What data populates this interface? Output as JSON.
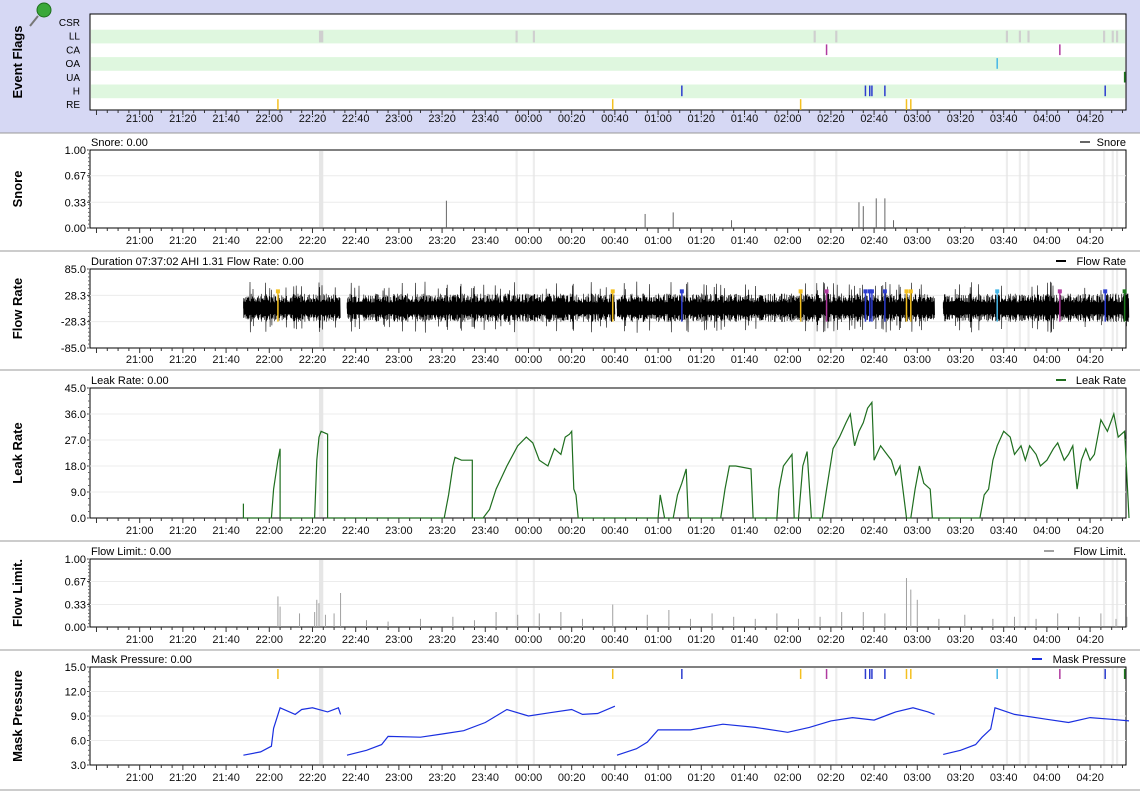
{
  "time_ticks": [
    "21:00",
    "21:20",
    "21:40",
    "22:00",
    "22:20",
    "22:40",
    "23:00",
    "23:20",
    "23:40",
    "00:00",
    "00:20",
    "00:40",
    "01:00",
    "01:20",
    "01:40",
    "02:00",
    "02:20",
    "02:40",
    "03:00",
    "03:20",
    "03:40",
    "04:00",
    "04:20"
  ],
  "colors": {
    "flag_band": "#dff7df",
    "flags_panel_bg": "#d6d8f4",
    "RE": "#f4c020",
    "H": "#2c3ccf",
    "CA": "#b03a9f",
    "OA": "#46b6e6",
    "UA": "#1b7a1b",
    "LL": "#cfcfcf",
    "snore": "#666666",
    "flow": "#000000",
    "leak": "#1f6e1f",
    "flowlim": "#a0a0a0",
    "pressure": "#1a2fe0"
  },
  "icons": {
    "flags_icon": "pushpin-icon"
  },
  "chart_data": [
    {
      "type": "event-flags",
      "ylabel": "Event Flags",
      "rows": [
        "CSR",
        "LL",
        "CA",
        "OA",
        "UA",
        "H",
        "RE"
      ],
      "events": {
        "LL": [
          [
            "22:23",
            "22:25"
          ],
          [
            "23:54",
            "23:55"
          ],
          [
            "00:02",
            "00:03"
          ],
          [
            "02:12",
            "02:13"
          ],
          [
            "02:22",
            "02:23"
          ],
          [
            "03:41",
            "03:42"
          ],
          [
            "03:47",
            "03:48"
          ],
          [
            "03:51",
            "03:52"
          ],
          [
            "04:26",
            "04:27"
          ],
          [
            "04:30",
            "04:31"
          ],
          [
            "04:32",
            "04:33"
          ]
        ],
        "CA": [
          "02:18",
          "04:06"
        ],
        "OA": [
          "03:37"
        ],
        "UA": [
          "04:36"
        ],
        "H": [
          "01:11",
          "02:36",
          "02:38",
          "02:39",
          "02:45",
          "04:27"
        ],
        "RE": [
          "22:04",
          "00:39",
          "02:06",
          "02:55",
          "02:57"
        ]
      }
    },
    {
      "type": "line",
      "ylabel": "Snore",
      "title": "Snore: 0.00",
      "legend": "Snore",
      "yticks": [
        "1.00",
        "0.67",
        "0.33",
        "0.00"
      ],
      "ylim": [
        0,
        1
      ],
      "spikes": [
        [
          "23:22",
          0.35
        ],
        [
          "00:54",
          0.18
        ],
        [
          "01:07",
          0.2
        ],
        [
          "01:34",
          0.1
        ],
        [
          "02:33",
          0.33
        ],
        [
          "02:35",
          0.28
        ],
        [
          "02:41",
          0.38
        ],
        [
          "02:45",
          0.38
        ],
        [
          "02:49",
          0.1
        ],
        [
          "03:22",
          0.02
        ]
      ]
    },
    {
      "type": "line",
      "ylabel": "Flow Rate",
      "title": "Duration 07:37:02 AHI 1.31 Flow Rate: 0.00",
      "legend": "Flow Rate",
      "yticks": [
        "85.0",
        "28.3",
        "-28.3",
        "-85.0"
      ],
      "ylim": [
        -85,
        85
      ],
      "segments": [
        [
          "21:48",
          "22:33"
        ],
        [
          "22:36",
          "00:40"
        ],
        [
          "00:41",
          "03:08"
        ],
        [
          "03:12",
          "04:38"
        ]
      ]
    },
    {
      "type": "line",
      "ylabel": "Leak Rate",
      "title": "Leak Rate: 0.00",
      "legend": "Leak Rate",
      "yticks": [
        "45.0",
        "36.0",
        "27.0",
        "18.0",
        "9.0",
        "0.0"
      ],
      "ylim": [
        0,
        45
      ],
      "points": [
        [
          "21:48",
          0
        ],
        [
          "21:48",
          5
        ],
        [
          "21:48",
          0
        ],
        [
          "22:01",
          0
        ],
        [
          "22:02",
          10
        ],
        [
          "22:04",
          20
        ],
        [
          "22:05",
          24
        ],
        [
          "22:05",
          0
        ],
        [
          "22:21",
          0
        ],
        [
          "22:22",
          20
        ],
        [
          "22:23",
          28
        ],
        [
          "22:24",
          30
        ],
        [
          "22:27",
          29
        ],
        [
          "22:27",
          0
        ],
        [
          "23:21",
          0
        ],
        [
          "23:23",
          8
        ],
        [
          "23:25",
          18
        ],
        [
          "23:26",
          21
        ],
        [
          "23:29",
          20
        ],
        [
          "23:34",
          20
        ],
        [
          "23:34",
          0
        ],
        [
          "23:39",
          0
        ],
        [
          "23:42",
          3
        ],
        [
          "23:45",
          10
        ],
        [
          "23:50",
          18
        ],
        [
          "23:55",
          25
        ],
        [
          "23:59",
          28
        ],
        [
          "00:02",
          26
        ],
        [
          "00:05",
          20
        ],
        [
          "00:09",
          18
        ],
        [
          "00:12",
          24
        ],
        [
          "00:15",
          22
        ],
        [
          "00:17",
          28
        ],
        [
          "00:19",
          29
        ],
        [
          "00:20",
          30
        ],
        [
          "00:21",
          10
        ],
        [
          "00:22",
          8
        ],
        [
          "00:23",
          0
        ],
        [
          "01:00",
          0
        ],
        [
          "01:01",
          8
        ],
        [
          "01:03",
          0
        ],
        [
          "01:07",
          0
        ],
        [
          "01:09",
          8
        ],
        [
          "01:11",
          12
        ],
        [
          "01:13",
          17
        ],
        [
          "01:14",
          0
        ],
        [
          "01:29",
          0
        ],
        [
          "01:31",
          10
        ],
        [
          "01:33",
          18
        ],
        [
          "01:36",
          18
        ],
        [
          "01:43",
          17
        ],
        [
          "01:44",
          0
        ],
        [
          "01:55",
          0
        ],
        [
          "01:56",
          10
        ],
        [
          "01:58",
          18
        ],
        [
          "02:02",
          22
        ],
        [
          "02:03",
          0
        ],
        [
          "02:05",
          0
        ],
        [
          "02:07",
          18
        ],
        [
          "02:09",
          23
        ],
        [
          "02:11",
          0
        ],
        [
          "02:16",
          0
        ],
        [
          "02:18",
          10
        ],
        [
          "02:21",
          24
        ],
        [
          "02:24",
          28
        ],
        [
          "02:27",
          33
        ],
        [
          "02:29",
          36
        ],
        [
          "02:31",
          25
        ],
        [
          "02:33",
          30
        ],
        [
          "02:35",
          33
        ],
        [
          "02:37",
          38
        ],
        [
          "02:39",
          40
        ],
        [
          "02:40",
          20
        ],
        [
          "02:43",
          25
        ],
        [
          "02:45",
          23
        ],
        [
          "02:48",
          20
        ],
        [
          "02:50",
          15
        ],
        [
          "02:52",
          18
        ],
        [
          "02:55",
          0
        ],
        [
          "02:57",
          0
        ],
        [
          "02:59",
          10
        ],
        [
          "03:01",
          18
        ],
        [
          "03:03",
          12
        ],
        [
          "03:06",
          10
        ],
        [
          "03:07",
          0
        ],
        [
          "03:29",
          0
        ],
        [
          "03:31",
          8
        ],
        [
          "03:33",
          10
        ],
        [
          "03:35",
          20
        ],
        [
          "03:37",
          25
        ],
        [
          "03:40",
          30
        ],
        [
          "03:43",
          28
        ],
        [
          "03:45",
          22
        ],
        [
          "03:48",
          25
        ],
        [
          "03:50",
          20
        ],
        [
          "03:52",
          25
        ],
        [
          "03:55",
          22
        ],
        [
          "03:57",
          18
        ],
        [
          "04:00",
          20
        ],
        [
          "04:03",
          24
        ],
        [
          "04:05",
          26
        ],
        [
          "04:08",
          20
        ],
        [
          "04:10",
          22
        ],
        [
          "04:12",
          25
        ],
        [
          "04:14",
          10
        ],
        [
          "04:16",
          20
        ],
        [
          "04:18",
          24
        ],
        [
          "04:20",
          20
        ],
        [
          "04:22",
          22
        ],
        [
          "04:25",
          34
        ],
        [
          "04:28",
          30
        ],
        [
          "04:31",
          36
        ],
        [
          "04:33",
          28
        ],
        [
          "04:36",
          30
        ],
        [
          "04:38",
          0
        ]
      ]
    },
    {
      "type": "line",
      "ylabel": "Flow Limit.",
      "title": "Flow Limit.: 0.00",
      "legend": "Flow Limit.",
      "yticks": [
        "1.00",
        "0.67",
        "0.33",
        "0.00"
      ],
      "ylim": [
        0,
        1
      ],
      "spikes": [
        [
          "22:04",
          0.45
        ],
        [
          "22:05",
          0.3
        ],
        [
          "22:14",
          0.2
        ],
        [
          "22:21",
          0.22
        ],
        [
          "22:22",
          0.4
        ],
        [
          "22:23",
          0.35
        ],
        [
          "22:26",
          0.18
        ],
        [
          "22:30",
          0.2
        ],
        [
          "22:33",
          0.5
        ],
        [
          "22:45",
          0.1
        ],
        [
          "22:55",
          0.08
        ],
        [
          "23:10",
          0.12
        ],
        [
          "23:25",
          0.15
        ],
        [
          "23:35",
          0.1
        ],
        [
          "23:45",
          0.22
        ],
        [
          "23:55",
          0.18
        ],
        [
          "00:05",
          0.2
        ],
        [
          "00:15",
          0.22
        ],
        [
          "00:25",
          0.12
        ],
        [
          "00:39",
          0.33
        ],
        [
          "00:55",
          0.18
        ],
        [
          "01:05",
          0.25
        ],
        [
          "01:15",
          0.12
        ],
        [
          "01:25",
          0.2
        ],
        [
          "01:35",
          0.15
        ],
        [
          "01:45",
          0.12
        ],
        [
          "01:55",
          0.2
        ],
        [
          "02:05",
          0.12
        ],
        [
          "02:15",
          0.15
        ],
        [
          "02:25",
          0.22
        ],
        [
          "02:35",
          0.22
        ],
        [
          "02:45",
          0.2
        ],
        [
          "02:55",
          0.72
        ],
        [
          "02:57",
          0.55
        ],
        [
          "03:00",
          0.4
        ],
        [
          "03:10",
          0.12
        ],
        [
          "03:22",
          0.18
        ],
        [
          "03:35",
          0.12
        ],
        [
          "03:45",
          0.15
        ],
        [
          "03:55",
          0.12
        ],
        [
          "04:05",
          0.2
        ],
        [
          "04:15",
          0.15
        ],
        [
          "04:25",
          0.2
        ],
        [
          "04:32",
          0.12
        ],
        [
          "04:37",
          0.15
        ]
      ]
    },
    {
      "type": "line",
      "ylabel": "Mask Pressure",
      "title": "Mask Pressure: 0.00",
      "legend": "Mask Pressure",
      "yticks": [
        "15.0",
        "12.0",
        "9.0",
        "6.0",
        "3.0"
      ],
      "ylim": [
        3,
        15
      ],
      "points": [
        [
          "21:48",
          4.2
        ],
        [
          "21:56",
          4.6
        ],
        [
          "22:01",
          5.3
        ],
        [
          "22:02",
          7.5
        ],
        [
          "22:05",
          10
        ],
        [
          "22:12",
          9.2
        ],
        [
          "22:15",
          9.8
        ],
        [
          "22:20",
          10
        ],
        [
          "22:27",
          9.5
        ],
        [
          "22:32",
          10
        ],
        [
          "22:33",
          9.2
        ],
        null,
        [
          "22:36",
          4.2
        ],
        [
          "22:45",
          4.8
        ],
        [
          "22:52",
          5.5
        ],
        [
          "22:55",
          6.5
        ],
        [
          "23:10",
          6.4
        ],
        [
          "23:20",
          6.8
        ],
        [
          "23:30",
          7.2
        ],
        [
          "23:40",
          8.2
        ],
        [
          "23:50",
          9.8
        ],
        [
          "00:00",
          9.0
        ],
        [
          "00:10",
          9.4
        ],
        [
          "00:20",
          9.8
        ],
        [
          "00:25",
          9.2
        ],
        [
          "00:32",
          9.3
        ],
        [
          "00:40",
          10.2
        ],
        null,
        [
          "00:41",
          4.2
        ],
        [
          "00:50",
          5
        ],
        [
          "00:55",
          5.8
        ],
        [
          "01:00",
          7.3
        ],
        [
          "01:15",
          7.3
        ],
        [
          "01:30",
          8.0
        ],
        [
          "01:45",
          7.6
        ],
        [
          "02:00",
          7.0
        ],
        [
          "02:10",
          7.6
        ],
        [
          "02:20",
          8.4
        ],
        [
          "02:30",
          8.8
        ],
        [
          "02:40",
          8.5
        ],
        [
          "02:50",
          9.5
        ],
        [
          "02:58",
          10.0
        ],
        [
          "03:05",
          9.5
        ],
        [
          "03:08",
          9.2
        ],
        null,
        [
          "03:12",
          4.3
        ],
        [
          "03:20",
          4.8
        ],
        [
          "03:27",
          5.5
        ],
        [
          "03:30",
          6.4
        ],
        [
          "03:34",
          7.4
        ],
        [
          "03:36",
          10.0
        ],
        [
          "03:45",
          9.2
        ],
        [
          "04:00",
          8.6
        ],
        [
          "04:10",
          8.2
        ],
        [
          "04:20",
          8.8
        ],
        [
          "04:30",
          8.6
        ],
        [
          "04:38",
          8.4
        ]
      ],
      "markers": {
        "RE": [
          "22:04",
          "00:39",
          "02:06",
          "02:55",
          "02:57"
        ],
        "CA": [
          "02:18",
          "04:06"
        ],
        "H": [
          "01:11",
          "02:36",
          "02:38",
          "02:39",
          "02:45",
          "04:27"
        ],
        "OA": [
          "03:37"
        ],
        "UA": [
          "04:36"
        ]
      }
    }
  ]
}
